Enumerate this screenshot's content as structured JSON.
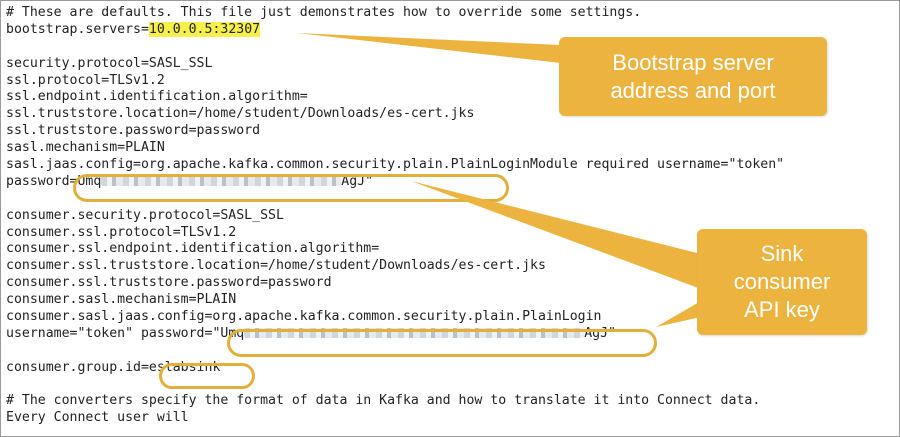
{
  "code_lines": [
    "# These are defaults. This file just demonstrates how to override some settings.",
    "bootstrap.servers=",
    "",
    "security.protocol=SASL_SSL",
    "ssl.protocol=TLSv1.2",
    "ssl.endpoint.identification.algorithm=",
    "ssl.truststore.location=/home/student/Downloads/es-cert.jks",
    "ssl.truststore.password=password",
    "sasl.mechanism=PLAIN",
    "sasl.jaas.config=org.apache.kafka.common.security.plain.PlainLoginModule required username=\"token\"",
    "password=",
    "",
    "consumer.security.protocol=SASL_SSL",
    "consumer.ssl.protocol=TLSv1.2",
    "consumer.ssl.endpoint.identification.algorithm=",
    "consumer.ssl.truststore.location=/home/student/Downloads/es-cert.jks",
    "consumer.ssl.truststore.password=password",
    "consumer.sasl.mechanism=PLAIN",
    "consumer.sasl.jaas.config=org.apache.kafka.common.security.plain.PlainLogin",
    "username=\"token\" password=",
    "",
    "consumer.group.id=",
    "",
    "# The converters specify the format of data in Kafka and how to translate it into Connect data.",
    "Every Connect user will"
  ],
  "bootstrap_value": "10.0.0.5:32307",
  "password_visible_start": "Umq",
  "password_visible_end": "AgJ\"",
  "consumer_password_visible_start": "\"Umq",
  "consumer_password_visible_end": "AgJ\"",
  "group_id_value": "eslabsink",
  "callouts": {
    "bootstrap": "Bootstrap server address and port",
    "sink_key": "Sink consumer API key"
  },
  "colors": {
    "callout_fill": "#ecb43f",
    "highlight": "#f7ef4a",
    "oval_stroke": "#e3ae3a"
  }
}
